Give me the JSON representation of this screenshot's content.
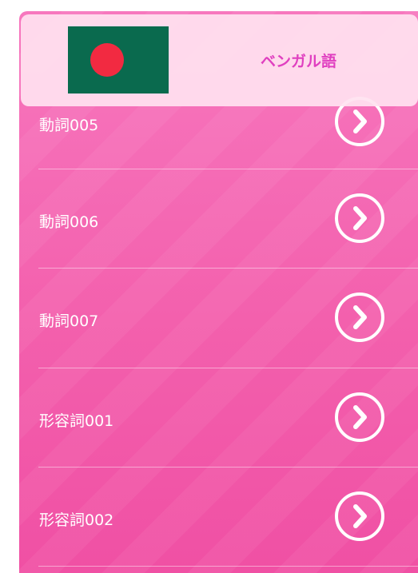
{
  "header": {
    "language_title": "ベンガル語",
    "flag_icon": "bangladesh-flag-icon",
    "flag_colors": {
      "field": "#0a6a4e",
      "disc": "#f22a41"
    }
  },
  "theme": {
    "background": "#f360ad",
    "accent_text": "#e040c0"
  },
  "items": [
    {
      "label": "動詞005",
      "icon": "chevron-right-circle-icon"
    },
    {
      "label": "動詞006",
      "icon": "chevron-right-circle-icon"
    },
    {
      "label": "動詞007",
      "icon": "chevron-right-circle-icon"
    },
    {
      "label": "形容詞001",
      "icon": "chevron-right-circle-icon"
    },
    {
      "label": "形容詞002",
      "icon": "chevron-right-circle-icon"
    }
  ]
}
